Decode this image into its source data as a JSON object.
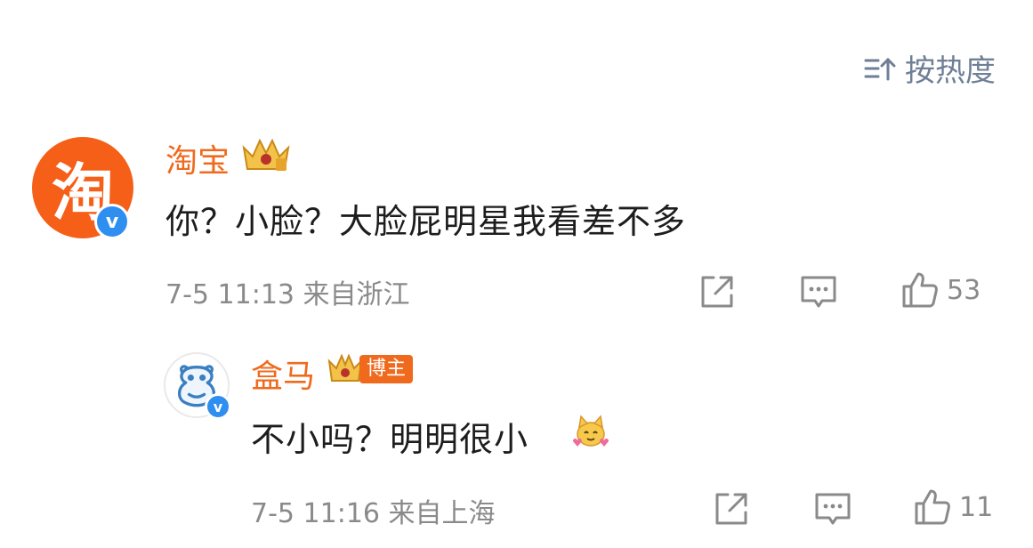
{
  "sort": {
    "label": "按热度"
  },
  "comments": [
    {
      "author": "淘宝",
      "avatar_char": "淘",
      "text": "你？小脸？大脸屁明星我看差不多",
      "time": "7-5 11:13",
      "location": "来自浙江",
      "likes": "53"
    }
  ],
  "reply": {
    "author": "盒马",
    "badge": "博主",
    "text": "不小吗？明明很小",
    "time": "7-5 11:16",
    "location": "来自上海",
    "likes": "11"
  },
  "verified_mark": "v",
  "colors": {
    "brand_orange": "#f06a1e",
    "avatar_orange": "#f55f18",
    "verified_blue": "#2f8ff0",
    "meta_gray": "#8a8a8a"
  }
}
